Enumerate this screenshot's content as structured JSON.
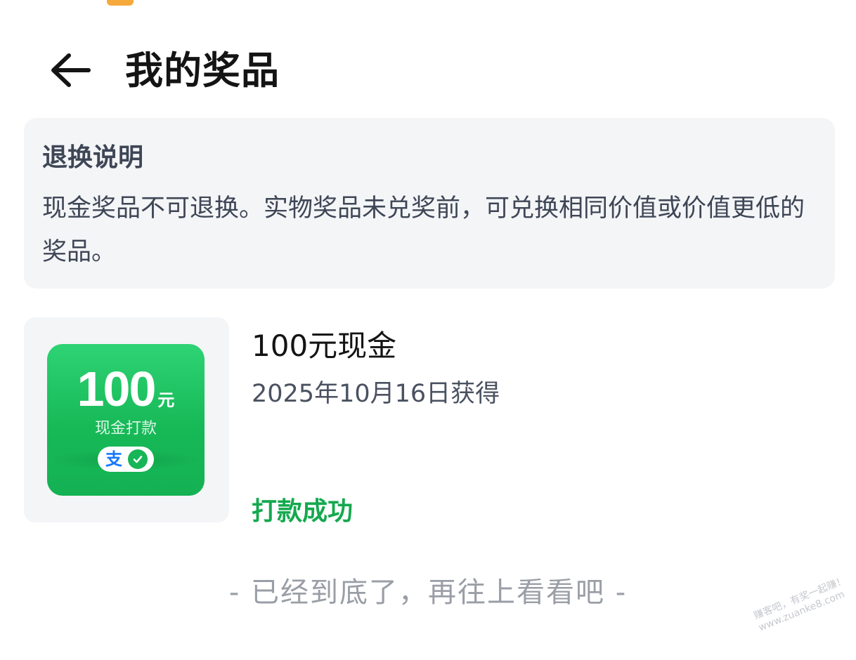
{
  "header": {
    "title": "我的奖品"
  },
  "policy": {
    "title": "退换说明",
    "body": "现金奖品不可退换。实物奖品未兑奖前，可兑换相同价值或价值更低的奖品。"
  },
  "prize": {
    "card_amount": "100",
    "card_unit": "元",
    "card_subtitle": "现金打款",
    "name": "100元现金",
    "date": "2025年10月16日获得",
    "status": "打款成功"
  },
  "footer": {
    "end_text": "- 已经到底了，再往上看看吧 -"
  },
  "watermark": {
    "line1": "赚客吧，有奖一起赚！",
    "line2": "www.zuanke8.com"
  },
  "colors": {
    "accent_green": "#14a94e",
    "card_green": "#17b957",
    "alipay_blue": "#1677ff"
  },
  "icons": {
    "back": "arrow-left-icon",
    "alipay": "alipay-icon",
    "wechat": "wechat-check-icon"
  }
}
